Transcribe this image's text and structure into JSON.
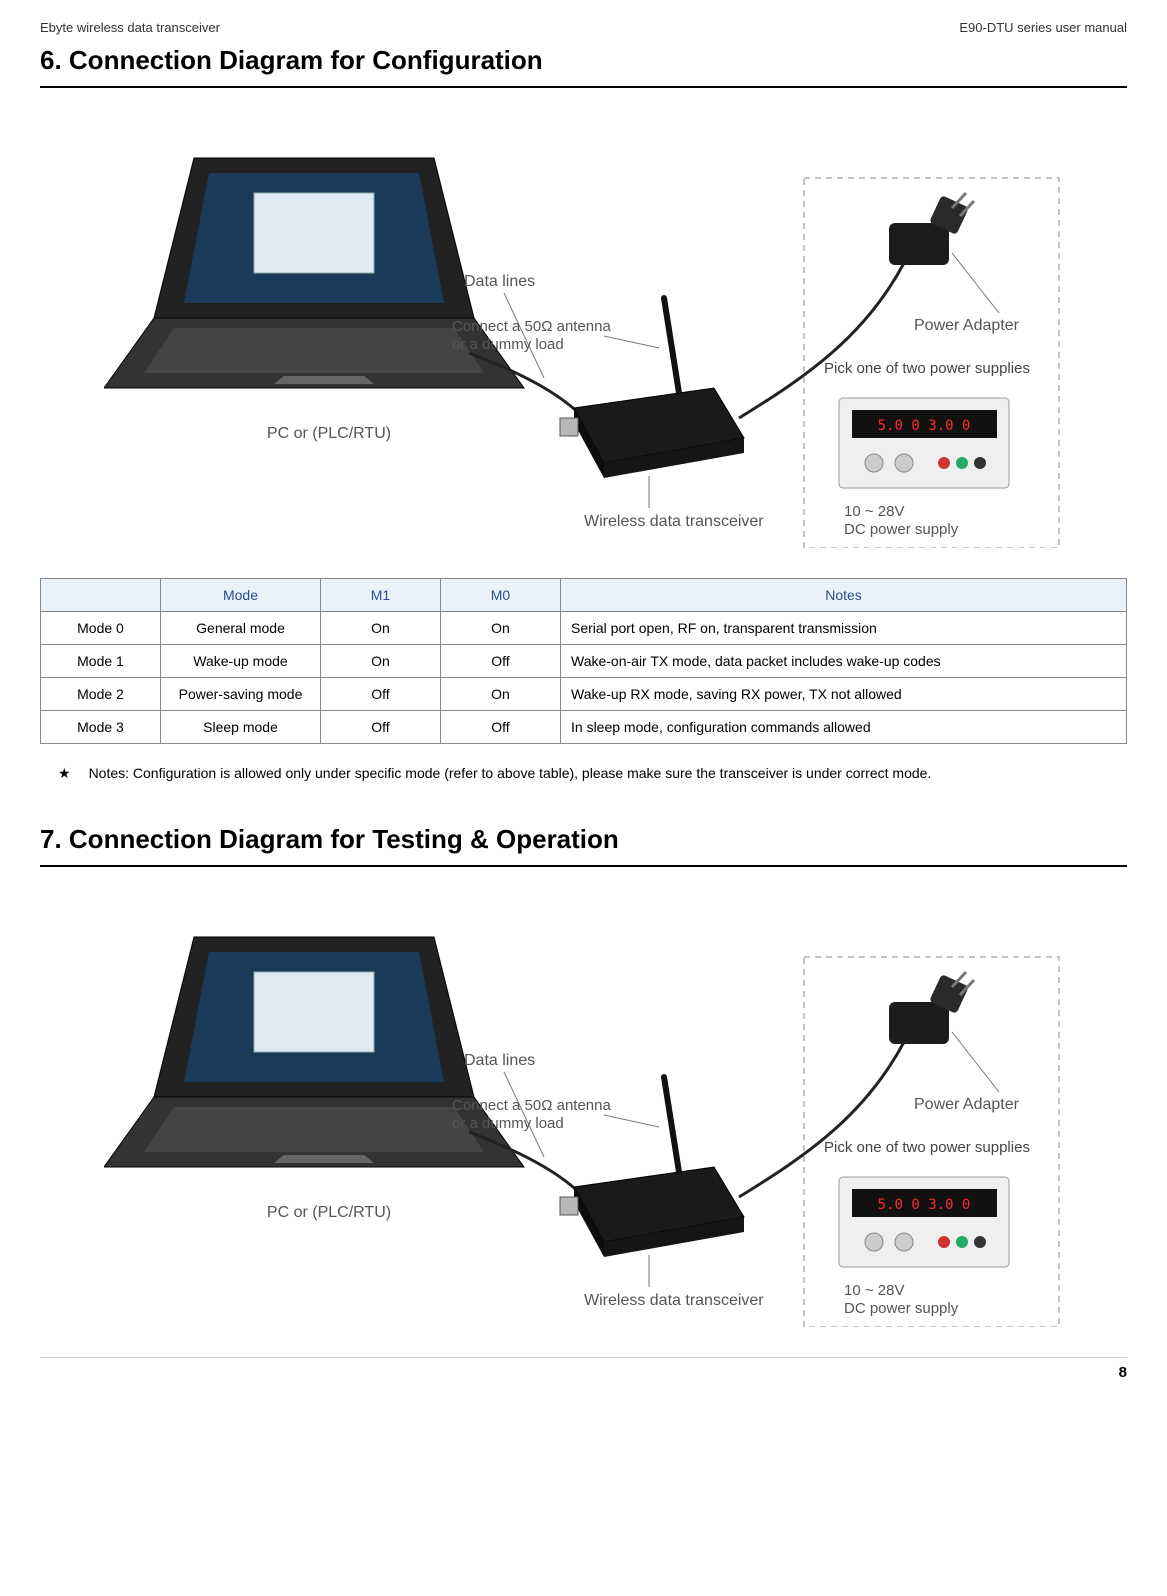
{
  "header": {
    "left": "Ebyte wireless data transceiver",
    "right": "E90-DTU series user manual"
  },
  "section6": {
    "title": "6.  Connection Diagram for Configuration"
  },
  "diagram_labels": {
    "data_lines": "Data lines",
    "connect_antenna_l1": "Connect a 50Ω antenna",
    "connect_antenna_l2": "or a dummy load",
    "power_adapter": "Power Adapter",
    "pick_one": "Pick one of two power supplies",
    "wireless_transceiver": "Wireless data transceiver",
    "pc_or": "PC or (PLC/RTU)",
    "dc_supply_l1": "10 ~ 28V",
    "dc_supply_l2": "DC power supply",
    "psu_display": "5.0 0  3.0 0"
  },
  "table": {
    "headers": [
      "",
      "Mode",
      "M1",
      "M0",
      "Notes"
    ],
    "rows": [
      {
        "c0": "Mode 0",
        "c1": "General mode",
        "c2": "On",
        "c3": "On",
        "c4": "Serial port open, RF on, transparent transmission"
      },
      {
        "c0": "Mode 1",
        "c1": "Wake-up mode",
        "c2": "On",
        "c3": "Off",
        "c4": "Wake-on-air TX mode, data packet includes wake-up codes"
      },
      {
        "c0": "Mode 2",
        "c1": "Power-saving mode",
        "c2": "Off",
        "c3": "On",
        "c4": "Wake-up RX mode, saving RX power, TX not allowed"
      },
      {
        "c0": "Mode 3",
        "c1": "Sleep mode",
        "c2": "Off",
        "c3": "Off",
        "c4": "In sleep mode, configuration commands allowed"
      }
    ]
  },
  "note": {
    "star": "★",
    "text": "Notes: Configuration is allowed only under specific mode (refer to above table), please make sure the transceiver is under correct mode."
  },
  "section7": {
    "title": "7.  Connection Diagram for Testing & Operation"
  },
  "footer": {
    "page": "8"
  }
}
